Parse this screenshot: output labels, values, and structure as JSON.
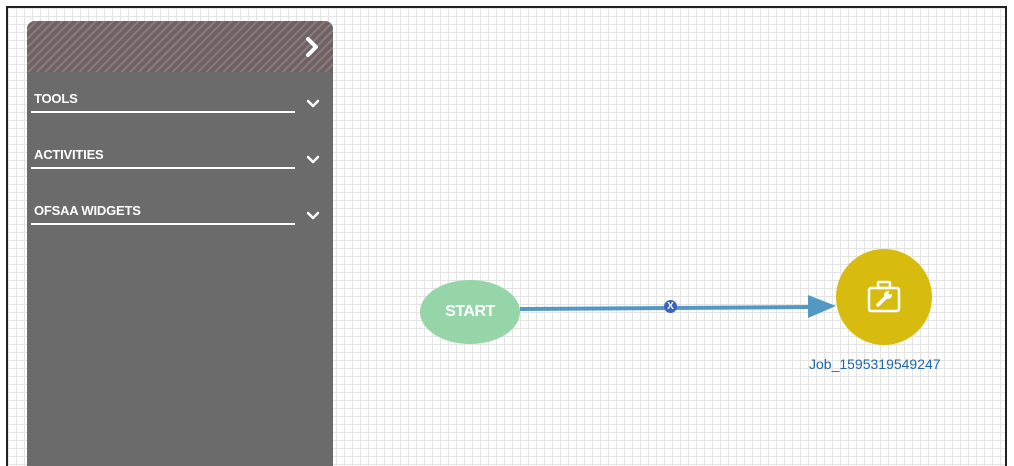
{
  "palette": {
    "sections": [
      {
        "label": "TOOLS"
      },
      {
        "label": "ACTIVITIES"
      },
      {
        "label": "OFSAA WIDGETS"
      }
    ]
  },
  "workflow": {
    "start_node": {
      "label": "START"
    },
    "job_node": {
      "label": "Job_1595319549247",
      "icon": "toolbox-wrench-icon"
    },
    "connector": {
      "delete_symbol": "X"
    }
  },
  "colors": {
    "start_node": "#95d5a8",
    "job_node": "#d7bc0f",
    "connector": "#5298c2",
    "job_label": "#1f66a5",
    "palette_bg": "#6b6b6b"
  }
}
